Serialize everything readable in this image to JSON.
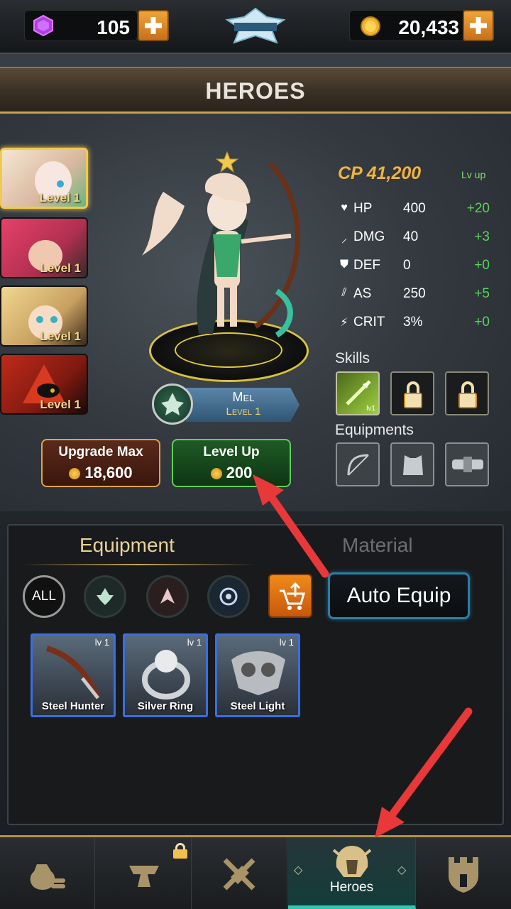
{
  "top_bar": {
    "gems": "105",
    "gold": "20,433",
    "logo_alt": "Idle Defense"
  },
  "banner": {
    "title": "HEROES"
  },
  "hero_list": [
    {
      "level": "Level 1",
      "active": true
    },
    {
      "level": "Level 1",
      "active": false
    },
    {
      "level": "Level 1",
      "active": false
    },
    {
      "level": "Level 1",
      "active": false
    }
  ],
  "hero": {
    "name": "Mel",
    "level": "Level 1",
    "cp": "CP 41,200",
    "lv_up_tag": "Lv up",
    "stats": [
      {
        "icon": "heart-icon",
        "name": "HP",
        "value": "400",
        "delta": "+20"
      },
      {
        "icon": "sword-icon",
        "name": "DMG",
        "value": "40",
        "delta": "+3"
      },
      {
        "icon": "shield-icon",
        "name": "DEF",
        "value": "0",
        "delta": "+0"
      },
      {
        "icon": "claw-icon",
        "name": "AS",
        "value": "250",
        "delta": "+5"
      },
      {
        "icon": "lightning-icon",
        "name": "CRIT",
        "value": "3%",
        "delta": "+0"
      }
    ],
    "skills_label": "Skills",
    "skill_lv": "lv1",
    "equipments_label": "Equipments"
  },
  "actions": {
    "upgrade_label": "Upgrade Max",
    "upgrade_cost": "18,600",
    "levelup_label": "Level Up",
    "levelup_cost": "200"
  },
  "inventory": {
    "tab_equipment": "Equipment",
    "tab_material": "Material",
    "filter_all": "ALL",
    "auto_equip": "Auto Equip",
    "items": [
      {
        "name": "Steel Hunter",
        "level": "lv 1"
      },
      {
        "name": "Silver Ring",
        "level": "lv 1"
      },
      {
        "name": "Steel Light",
        "level": "lv 1"
      }
    ]
  },
  "bottom_nav": {
    "items": [
      {
        "icon": "money-bag-icon",
        "label": ""
      },
      {
        "icon": "anvil-icon",
        "label": ""
      },
      {
        "icon": "crossed-swords-icon",
        "label": ""
      },
      {
        "icon": "helmet-icon",
        "label": "Heroes"
      },
      {
        "icon": "castle-icon",
        "label": ""
      }
    ]
  },
  "colors": {
    "accent_gold": "#f2b23e",
    "positive_green": "#59d35a",
    "item_border_blue": "#3a6ee0",
    "arrow_red": "#e8383a"
  }
}
